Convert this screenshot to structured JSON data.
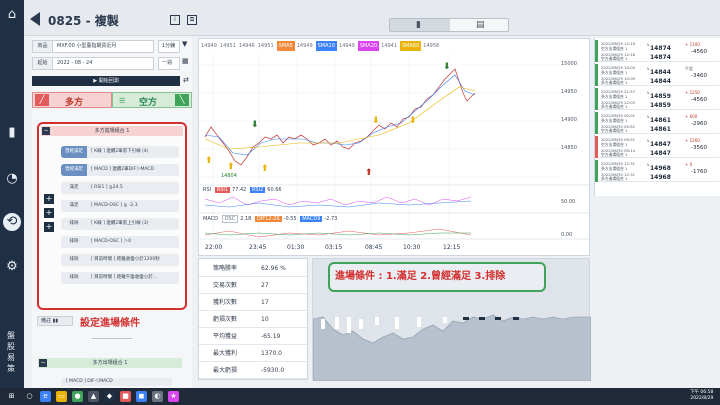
{
  "app": {
    "title": "0825 - 複製",
    "rail_brand": "盤股易策"
  },
  "settings": {
    "product_label": "商品",
    "product_value": "MXF.00 小型臺指期貨近月",
    "timeframe": "1分鐘",
    "date_label": "起始",
    "date_value": "2022 - 08 - 24",
    "period": "一週",
    "run_label": "▶ 開始回測"
  },
  "tabs": {
    "long": "多方",
    "short": "空方"
  },
  "entry": {
    "header": "多方進場組合 1",
    "rows": [
      {
        "tag": "曾經滿足",
        "text": "[ K線 ] 連續2筆黑下引線 (4)"
      },
      {
        "tag": "曾經滿足",
        "text": "[ MACD ] 連續2筆DIF＞MACD"
      },
      {
        "tag": "滿足",
        "text": "[ RSI1 ] ≧24.5"
      },
      {
        "tag": "滿足",
        "text": "[ MACD-OSC ] ≧ -2.3"
      },
      {
        "tag": "排除",
        "text": "[ K線 ] 連續2筆黑上引線 (3)"
      },
      {
        "tag": "排除",
        "text": "[ MACD-OSC ] ＞0"
      },
      {
        "tag": "排除",
        "text": "[ 目前時間 ] 距離收盤小於1200秒"
      },
      {
        "tag": "排除",
        "text": "[ 目前時間 ] 距離午盤收盤小於..."
      }
    ],
    "note_button": "備註",
    "annotation": "設定進場條件"
  },
  "exit": {
    "header": "多方出場組合 1",
    "row": "[ MACD ] DIF＜MACD"
  },
  "chart": {
    "ma_legend": [
      {
        "text": "14949",
        "chip": false
      },
      {
        "text": "14951",
        "chip": false
      },
      {
        "text": "14946",
        "chip": false
      },
      {
        "text": "14951",
        "chip": false
      },
      {
        "text": "SMA5",
        "chip": true,
        "color": "#f08a3a"
      },
      {
        "text": "14949",
        "chip": false
      },
      {
        "text": "SMA10",
        "chip": true,
        "color": "#3b82f6"
      },
      {
        "text": "14949",
        "chip": false
      },
      {
        "text": "SMA20",
        "chip": true,
        "color": "#d946ef"
      },
      {
        "text": "14941",
        "chip": false
      },
      {
        "text": "SMA60",
        "chip": true,
        "color": "#eab308"
      },
      {
        "text": "14958",
        "chip": false
      }
    ],
    "y_labels": [
      "15000",
      "14950",
      "14900",
      "14850"
    ],
    "low_label": "14804",
    "rsi": {
      "label": "RSI",
      "chip1": "RSI1",
      "v1": "77.42",
      "chip2": "RSI2",
      "v2": "60.66",
      "y": [
        "50.00",
        "0.00"
      ]
    },
    "macd": {
      "label": "MACD",
      "chip1": "OSC",
      "v1": "2.18",
      "chip2": "DIF12-26",
      "v2": "-0.55",
      "chip3": "MACD9",
      "v3": "-2.73"
    },
    "times": [
      "22:00",
      "23:45",
      "01:30",
      "03:15",
      "08:45",
      "10:30",
      "12:15"
    ]
  },
  "trades": [
    {
      "dt1": "2022/08/29 12:19",
      "dt2": "2022/08/29 12:18",
      "a1": "空方出場組合 1",
      "a2": "空方進場組合 1",
      "p1": "14874",
      "p2": "14874",
      "pnl": "+ 1100",
      "tot": "-4560",
      "color": "#3fa35a"
    },
    {
      "dt1": "2022/08/29 10:05",
      "dt2": "2022/08/29 10:05",
      "a1": "多方出場組合 1",
      "a2": "多方進場組合 1",
      "p1": "14844",
      "p2": "14844",
      "pnl": "平倉",
      "tot": "-3460",
      "color": "#3fa35a"
    },
    {
      "dt1": "2022/08/29 21:57",
      "dt2": "2022/08/29 22:03",
      "a1": "多方出場組合 1",
      "a2": "多方進場組合 1",
      "p1": "14859",
      "p2": "14859",
      "pnl": "+ 1250",
      "tot": "-4560",
      "color": "#3fa35a"
    },
    {
      "dt1": "2022/08/30 00:01",
      "dt2": "2022/08/30 00:52",
      "a1": "多方出場組合 1",
      "a2": "空方進場組合 1",
      "p1": "14861",
      "p2": "14861",
      "pnl": "+ 600",
      "tot": "-2960",
      "color": "#3fa35a"
    },
    {
      "dt1": "2022/08/30 09:51",
      "dt2": "2022/08/30 09:14",
      "a1": "空方出場組合 1",
      "a2": "空方進場組合 1",
      "p1": "14847",
      "p2": "14847",
      "pnl": "+ 1260",
      "tot": "-3560",
      "color": "#e25a5a"
    },
    {
      "dt1": "2022/08/30 12:31",
      "dt2": "2022/08/30 12:31",
      "a1": "多方出場組合 1",
      "a2": "多方進場組合 1",
      "p1": "14968",
      "p2": "14968",
      "pnl": "+ 0",
      "tot": "-1760",
      "color": "#3fa35a"
    }
  ],
  "stats": [
    {
      "k": "策略勝率",
      "v": "62.96 %"
    },
    {
      "k": "交易次數",
      "v": "27"
    },
    {
      "k": "獲利次數",
      "v": "17"
    },
    {
      "k": "虧損次數",
      "v": "10"
    },
    {
      "k": "平均獲益",
      "v": "-65.19"
    },
    {
      "k": "最大獲利",
      "v": "1370.0"
    },
    {
      "k": "最大虧損",
      "v": "-5930.0"
    }
  ],
  "callout": "進場條件 : 1.滿足 2.曾經滿足 3.排除",
  "taskbar": {
    "time": "下午 06:58",
    "date": "2022/8/29"
  }
}
